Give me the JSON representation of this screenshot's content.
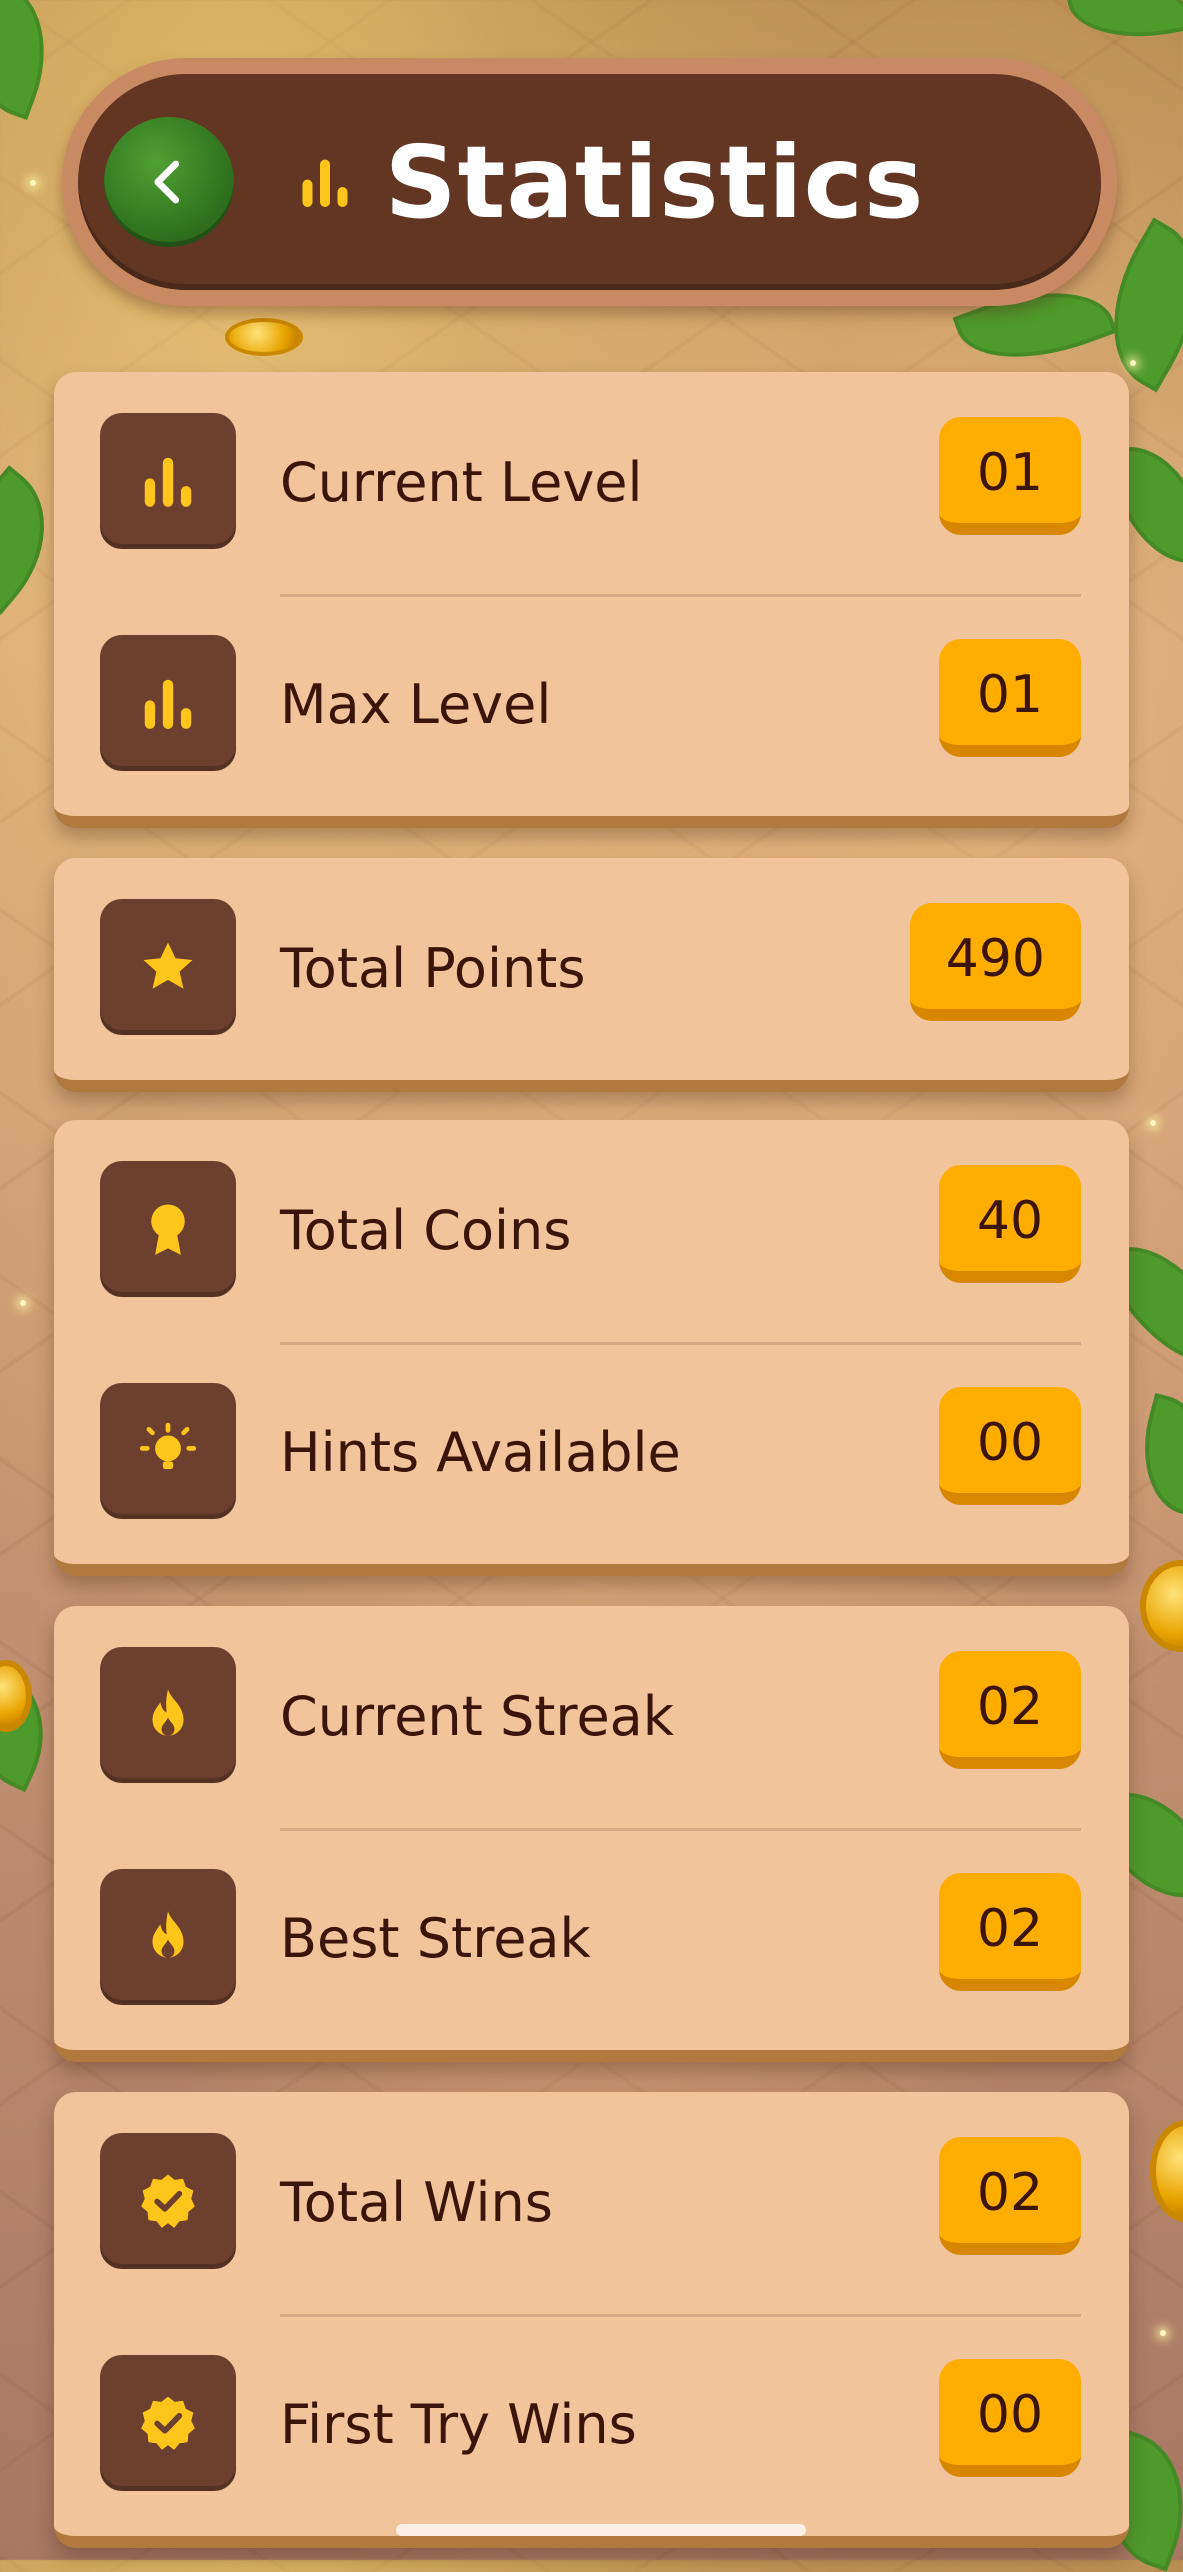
{
  "header": {
    "title": "Statistics",
    "back_icon": "chevron-left-icon",
    "title_icon": "bar-chart-icon"
  },
  "colors": {
    "card": "#f1c49b",
    "icon_box": "#6d3f2e",
    "badge": "#ffae00",
    "header": "#633623",
    "back_button": "#2d6d1c",
    "text": "#3b140a"
  },
  "groups": [
    {
      "items": [
        {
          "label": "Current Level",
          "value": "01",
          "icon": "bar-chart-icon"
        },
        {
          "label": "Max Level",
          "value": "01",
          "icon": "bar-chart-icon"
        }
      ]
    },
    {
      "items": [
        {
          "label": "Total Points",
          "value": "490",
          "icon": "star-icon"
        }
      ]
    },
    {
      "items": [
        {
          "label": "Total Coins",
          "value": "40",
          "icon": "medal-icon"
        },
        {
          "label": "Hints Available",
          "value": "00",
          "icon": "lightbulb-icon"
        }
      ]
    },
    {
      "items": [
        {
          "label": "Current Streak",
          "value": "02",
          "icon": "flame-icon"
        },
        {
          "label": "Best Streak",
          "value": "02",
          "icon": "flame-icon"
        }
      ]
    },
    {
      "items": [
        {
          "label": "Total Wins",
          "value": "02",
          "icon": "verified-badge-icon"
        },
        {
          "label": "First Try Wins",
          "value": "00",
          "icon": "verified-badge-icon"
        }
      ]
    }
  ]
}
